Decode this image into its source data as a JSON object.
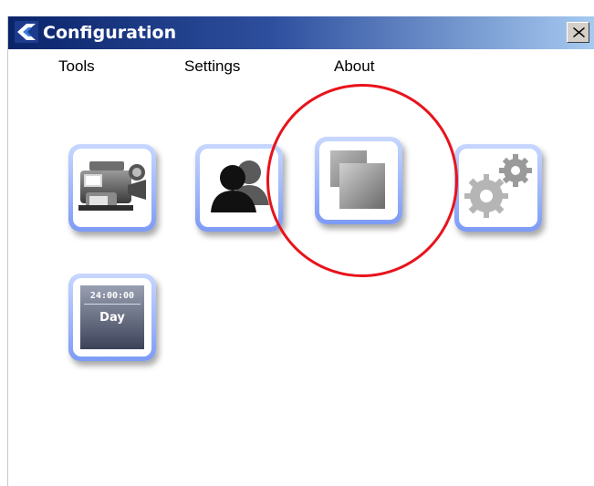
{
  "window": {
    "title": "Configuration",
    "close_glyph": "✕",
    "titlebar_colors": [
      "#0a246a",
      "#a6caf0"
    ]
  },
  "menu": {
    "items": [
      {
        "label": "Tools"
      },
      {
        "label": "Settings"
      },
      {
        "label": "About"
      }
    ]
  },
  "tiles": [
    {
      "icon": "video-camera-icon"
    },
    {
      "icon": "users-icon"
    },
    {
      "icon": "cascade-windows-icon",
      "highlighted": true
    },
    {
      "icon": "gears-icon"
    },
    {
      "icon": "clock-day-icon",
      "time": "24:00:00",
      "label": "Day"
    }
  ],
  "colors": {
    "tile_border": "#7d9bf5",
    "highlight_circle": "#e8131b"
  }
}
